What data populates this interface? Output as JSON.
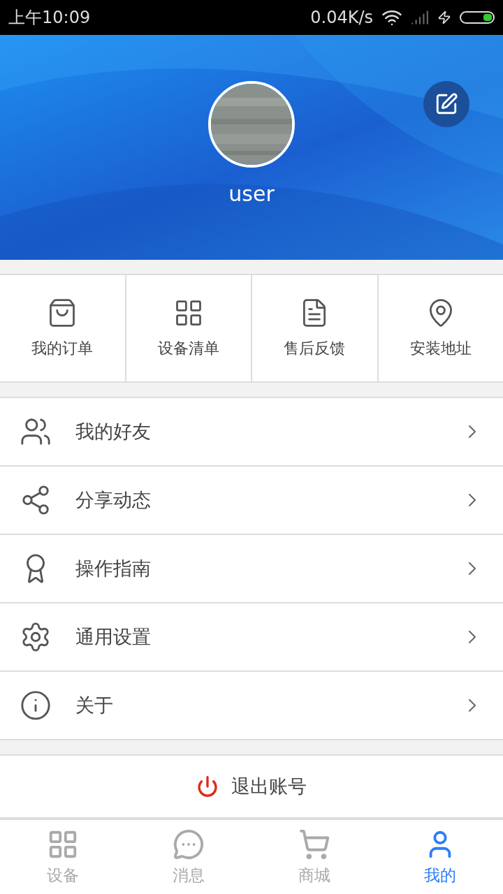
{
  "status_bar": {
    "time": "上午10:09",
    "speed": "0.04K/s"
  },
  "profile": {
    "username": "user"
  },
  "shortcuts": [
    {
      "label": "我的订单"
    },
    {
      "label": "设备清单"
    },
    {
      "label": "售后反馈"
    },
    {
      "label": "安装地址"
    }
  ],
  "menu": [
    {
      "label": "我的好友"
    },
    {
      "label": "分享动态"
    },
    {
      "label": "操作指南"
    },
    {
      "label": "通用设置"
    },
    {
      "label": "关于"
    }
  ],
  "logout": {
    "label": "退出账号"
  },
  "tabs": [
    {
      "label": "设备",
      "selected": false
    },
    {
      "label": "消息",
      "selected": false
    },
    {
      "label": "商城",
      "selected": false
    },
    {
      "label": "我的",
      "selected": true
    }
  ]
}
